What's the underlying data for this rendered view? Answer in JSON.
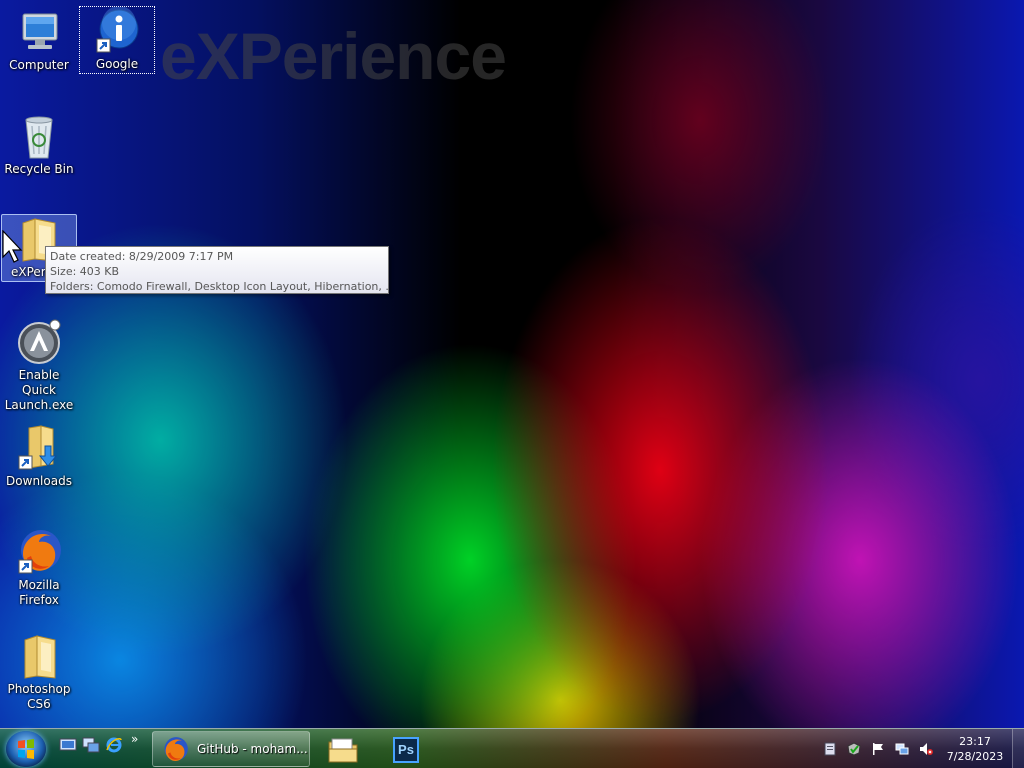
{
  "wallpaper": {
    "watermark_text": "eXPerience"
  },
  "desktop_icons": [
    {
      "label": "Computer",
      "icon": "computer-icon"
    },
    {
      "label": "Google",
      "icon": "info-shortcut-icon"
    },
    {
      "label": "Recycle Bin",
      "icon": "recycle-bin-icon"
    },
    {
      "label": "eXPerience",
      "label_visible": "eXPerie",
      "icon": "folder-icon"
    },
    {
      "label": "Enable Quick Launch.exe",
      "icon": "launcher-icon"
    },
    {
      "label": "Downloads",
      "icon": "downloads-folder-icon"
    },
    {
      "label": "Mozilla Firefox",
      "icon": "firefox-icon"
    },
    {
      "label": "Photoshop CS6",
      "icon": "folder-icon"
    }
  ],
  "tooltip": {
    "line1": "Date created: 8/29/2009 7:17 PM",
    "line2": "Size: 403 KB",
    "line3": "Folders: Comodo Firewall, Desktop Icon Layout, Hibernation, ..."
  },
  "taskbar": {
    "quick_launch": [
      "show-desktop-icon",
      "switch-windows-icon",
      "internet-explorer-icon"
    ],
    "quick_launch_more": "»",
    "tasks": [
      {
        "label": "GitHub - moham...",
        "icon": "firefox-icon",
        "active": true
      },
      {
        "label": "",
        "icon": "windows-explorer-icon",
        "active": false
      },
      {
        "label": "",
        "icon": "photoshop-icon",
        "icon_text": "Ps",
        "active": false
      }
    ],
    "tray_icons": [
      "action-center-icon",
      "security-icon",
      "flag-icon",
      "network-icon",
      "volume-muted-icon"
    ],
    "clock": {
      "time": "23:17",
      "date": "7/28/2023"
    }
  },
  "colors": {
    "accent": "#1c5fb0",
    "tooltip_text": "#575757",
    "photoshop": "#0b2a4a"
  }
}
